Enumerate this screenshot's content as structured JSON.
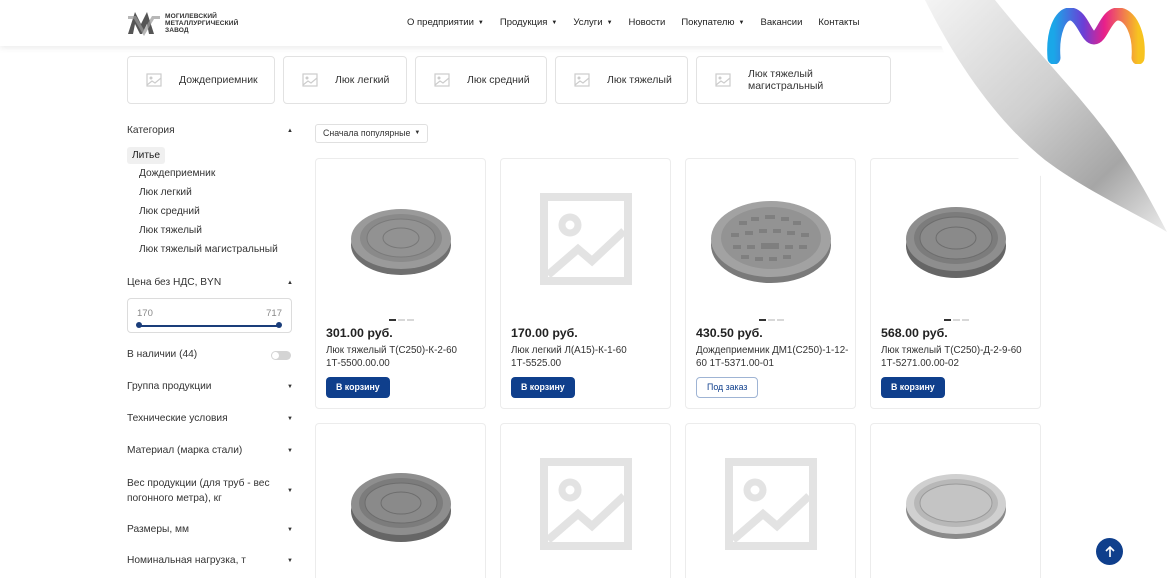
{
  "header": {
    "logo_lines": [
      "МОГИЛЕВСКИЙ",
      "МЕТАЛЛУРГИЧЕСКИЙ",
      "ЗАВОД"
    ],
    "nav": [
      {
        "label": "О предприятии",
        "dropdown": true
      },
      {
        "label": "Продукция",
        "dropdown": true
      },
      {
        "label": "Услуги",
        "dropdown": true
      },
      {
        "label": "Новости",
        "dropdown": false
      },
      {
        "label": "Покупателю",
        "dropdown": true
      },
      {
        "label": "Вакансии",
        "dropdown": false
      },
      {
        "label": "Контакты",
        "dropdown": false
      }
    ]
  },
  "chips": [
    {
      "label": "Дождеприемник"
    },
    {
      "label": "Люк легкий"
    },
    {
      "label": "Люк средний"
    },
    {
      "label": "Люк тяжелый"
    },
    {
      "label": "Люк тяжелый магистральный"
    }
  ],
  "sidebar": {
    "category_title": "Категория",
    "category_active": "Литье",
    "category_items": [
      "Дождеприемник",
      "Люк легкий",
      "Люк средний",
      "Люк тяжелый",
      "Люк тяжелый магистральный"
    ],
    "price_title": "Цена без НДС, BYN",
    "price_min": "170",
    "price_max": "717",
    "in_stock": "В наличии (44)",
    "filters": [
      "Группа продукции",
      "Технические условия",
      "Материал (марка стали)",
      "Вес продукции (для труб - вес погонного метра), кг",
      "Размеры, мм",
      "Номинальная нагрузка, т"
    ]
  },
  "sort": {
    "label": "Сначала популярные"
  },
  "products": [
    {
      "price": "301.00 руб.",
      "name": "Люк тяжелый Т(С250)-К-2-60 1Т-5500.00.00",
      "button": "В корзину",
      "button_type": "cart",
      "image": "manhole-cover-icon"
    },
    {
      "price": "170.00 руб.",
      "name": "Люк легкий Л(А15)-К-1-60 1Т-5525.00",
      "button": "В корзину",
      "button_type": "cart",
      "image": "image-placeholder-icon"
    },
    {
      "price": "430.50 руб.",
      "name": "Дождеприемник ДМ1(С250)-1-12-60 1Т-5371.00-01",
      "button": "Под заказ",
      "button_type": "order",
      "image": "rain-grate-icon"
    },
    {
      "price": "568.00 руб.",
      "name": "Люк тяжелый Т(С250)-Д-2-9-60 1Т-5271.00.00-02",
      "button": "В корзину",
      "button_type": "cart",
      "image": "manhole-cover-icon"
    },
    {
      "image": "manhole-cover-icon"
    },
    {
      "image": "image-placeholder-icon"
    },
    {
      "image": "image-placeholder-icon"
    },
    {
      "image": "manhole-cover-light-icon"
    }
  ],
  "colors": {
    "primary": "#0f3f8c",
    "border": "#e2e2e2",
    "text": "#222222"
  }
}
